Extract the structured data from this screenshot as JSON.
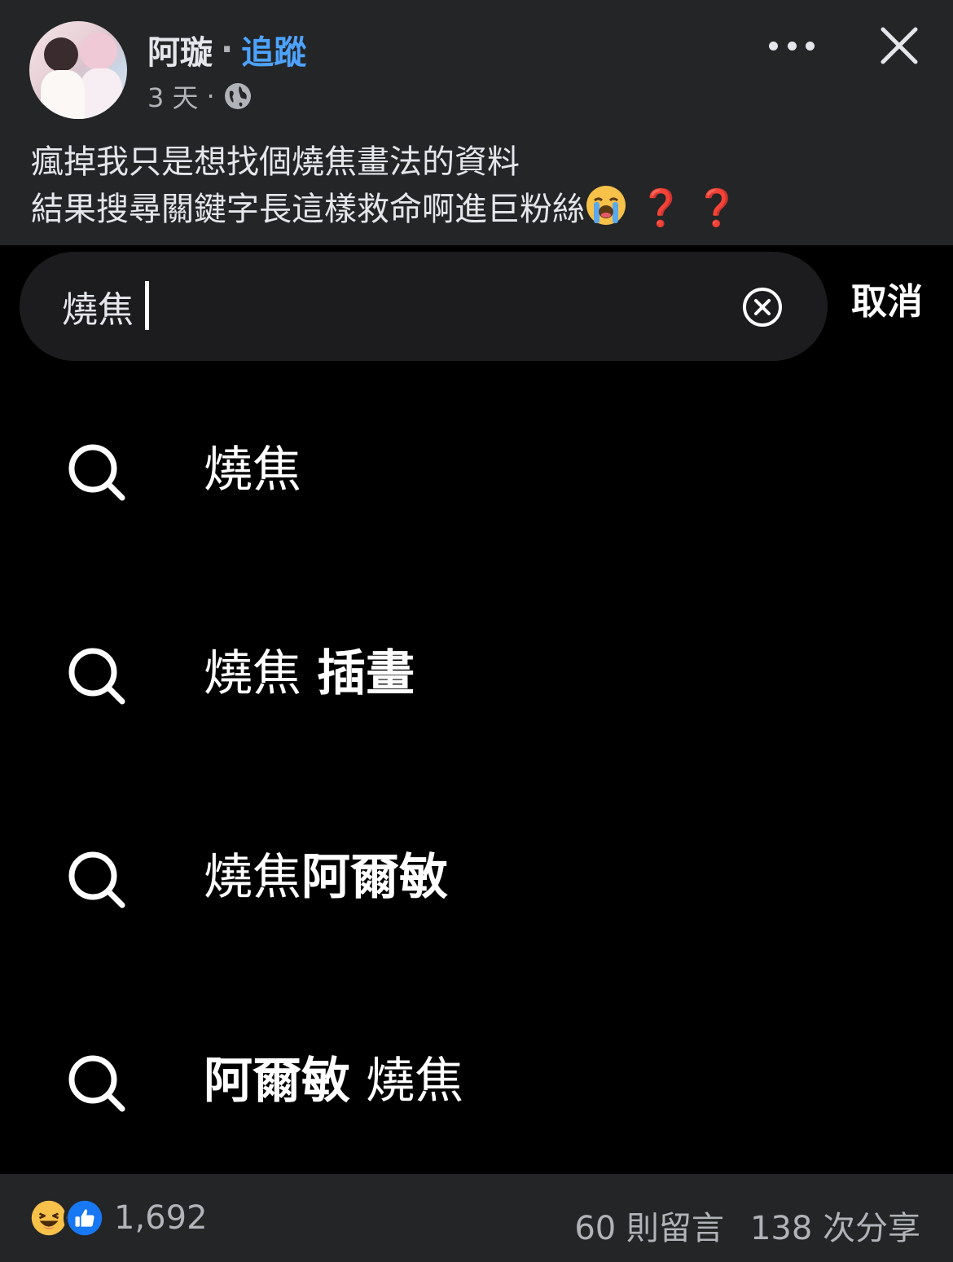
{
  "post": {
    "author": "阿璇",
    "separator": "·",
    "follow_label": "追蹤",
    "time": "3 天",
    "time_separator": "·",
    "audience_icon": "globe-icon",
    "text_line1": "瘋掉我只是想找個燒焦畫法的資料",
    "text_line2": "結果搜尋關鍵字長這樣救命啊進巨粉絲",
    "text_emoji": "😭",
    "qmark1": "❓",
    "qmark2": "❓"
  },
  "search": {
    "query": "燒焦",
    "cancel_label": "取消",
    "suggestions": [
      {
        "part1": "燒焦",
        "part2": ""
      },
      {
        "part1": "燒焦 ",
        "part2": "插畫"
      },
      {
        "part1": "燒焦",
        "part2": "阿爾敏"
      },
      {
        "part1": "阿爾敏",
        "part2": " 燒焦"
      }
    ]
  },
  "footer": {
    "reaction_count": "1,692",
    "comments": "60 則留言",
    "shares": "138 次分享"
  },
  "colors": {
    "background": "#242526",
    "accent_follow": "#4da3ff",
    "like_blue": "#1877f2",
    "haha_yellow": "#f7c14a",
    "question_red": "#e00000"
  }
}
